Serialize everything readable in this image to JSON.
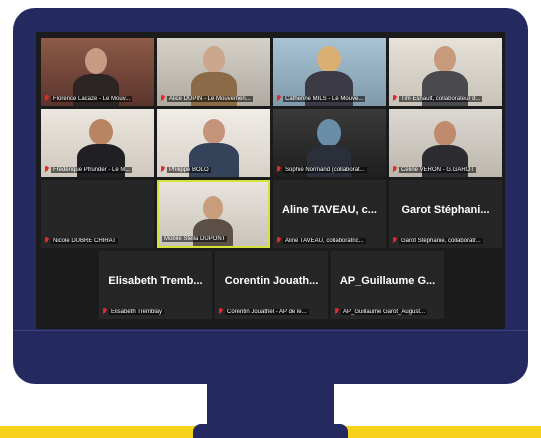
{
  "meeting": {
    "tiles": [
      {
        "id": "t1",
        "name": "Florence Lacaze - Le Mouv...",
        "video": true
      },
      {
        "id": "t2",
        "name": "Alice DUPIN - Le Mouvemen...",
        "video": true
      },
      {
        "id": "t3",
        "name": "Catherine MILS - Le Mouve...",
        "video": true
      },
      {
        "id": "t4",
        "name": "Tim Esnault, collaborateur d...",
        "video": true
      },
      {
        "id": "t5",
        "name": "Frédérique Pfrunder - Le M...",
        "video": true
      },
      {
        "id": "t6",
        "name": "Philippe BOLO",
        "video": true
      },
      {
        "id": "t7",
        "name": "Sophie Normand (collaborat...",
        "video": true
      },
      {
        "id": "t8",
        "name": "Celine VERON - G.GAROT",
        "video": true
      },
      {
        "id": "t9",
        "name": "Nicole DUBRÉ CHIRAT",
        "video": false,
        "big": ""
      },
      {
        "id": "t10",
        "name": "Mobile Stella DUPONT",
        "video": true,
        "active": true
      },
      {
        "id": "t11",
        "name": "Aline TAVEAU, collaboratric...",
        "video": false,
        "big": "Aline TAVEAU, c..."
      },
      {
        "id": "t12",
        "name": "Garot Stéphanie, collaboratr...",
        "video": false,
        "big": "Garot Stéphani..."
      },
      {
        "id": "t13",
        "name": "Elisabeth Tremblay",
        "video": false,
        "big": "Elisabeth Tremb..."
      },
      {
        "id": "t14",
        "name": "Corentin Jouathel - AP de le...",
        "video": false,
        "big": "Corentin Jouath..."
      },
      {
        "id": "t15",
        "name": "AP_Guillaume Garot_August...",
        "video": false,
        "big": "AP_Guillaume G..."
      }
    ]
  },
  "colors": {
    "monitor": "#242a60",
    "accent_yellow": "#f7d21c",
    "active_border": "#d5e23a",
    "muted_mic": "#e12b2b"
  }
}
